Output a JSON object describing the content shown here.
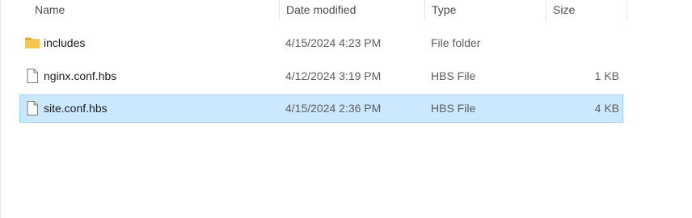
{
  "columns": {
    "name": "Name",
    "date_modified": "Date modified",
    "type": "Type",
    "size": "Size"
  },
  "rows": [
    {
      "name": "includes",
      "date": "4/15/2024 4:23 PM",
      "type": "File folder",
      "size": "",
      "icon": "folder-icon",
      "selected": false
    },
    {
      "name": "nginx.conf.hbs",
      "date": "4/12/2024 3:19 PM",
      "type": "HBS File",
      "size": "1 KB",
      "icon": "file-icon",
      "selected": false
    },
    {
      "name": "site.conf.hbs",
      "date": "4/15/2024 2:36 PM",
      "type": "HBS File",
      "size": "4 KB",
      "icon": "file-icon",
      "selected": true
    }
  ],
  "colors": {
    "selection_bg": "#cce8ff",
    "selection_border": "#99d1ff",
    "folder": "#f8c64b"
  }
}
